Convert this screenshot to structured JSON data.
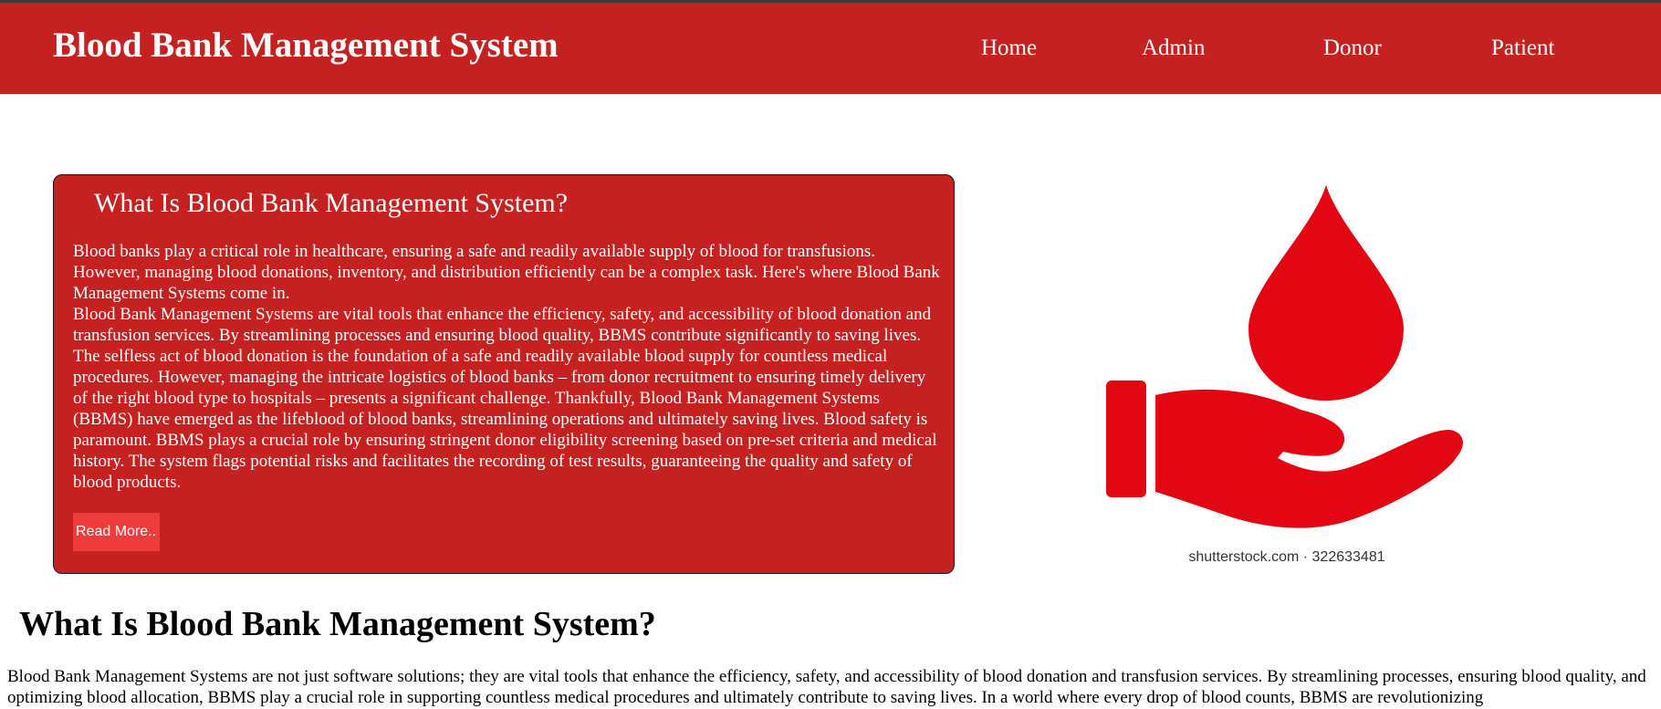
{
  "header": {
    "brand": "Blood Bank Management System",
    "nav": [
      "Home",
      "Admin",
      "Donor",
      "Patient"
    ],
    "background_color": "#c62121"
  },
  "intro_card": {
    "title": "What Is Blood Bank Management System?",
    "paragraph_1": "Blood banks play a critical role in healthcare, ensuring a safe and readily available supply of blood for transfusions. However, managing blood donations, inventory, and distribution efficiently can be a complex task. Here's where Blood Bank Management Systems come in.",
    "paragraph_2": "Blood Bank Management Systems are vital tools that enhance the efficiency, safety, and accessibility of blood donation and transfusion services. By streamlining processes and ensuring blood quality, BBMS contribute significantly to saving lives. The selfless act of blood donation is the foundation of a safe and readily available blood supply for countless medical procedures. However, managing the intricate logistics of blood banks – from donor recruitment to ensuring timely delivery of the right blood type to hospitals – presents a significant challenge. Thankfully, Blood Bank Management Systems (BBMS) have emerged as the lifeblood of blood banks, streamlining operations and ultimately saving lives. Blood safety is paramount. BBMS plays a crucial role by ensuring stringent donor eligibility screening based on pre-set criteria and medical history. The system flags potential risks and facilitates the recording of test results, guaranteeing the quality and safety of blood products.",
    "button_label": "Read More..",
    "button_color": "#ee3b3b"
  },
  "illustration": {
    "icon": "blood-drop-hand-icon",
    "caption": "shutterstock.com · 322633481",
    "color": "#e30613"
  },
  "section": {
    "title": "What Is Blood Bank Management System?",
    "text": "Blood Bank Management Systems are not just software solutions; they are vital tools that enhance the efficiency, safety, and accessibility of blood donation and transfusion services. By streamlining processes, ensuring blood quality, and optimizing blood allocation, BBMS play a crucial role in supporting countless medical procedures and ultimately contribute to saving lives. In a world where every drop of blood counts, BBMS are revolutionizing"
  }
}
